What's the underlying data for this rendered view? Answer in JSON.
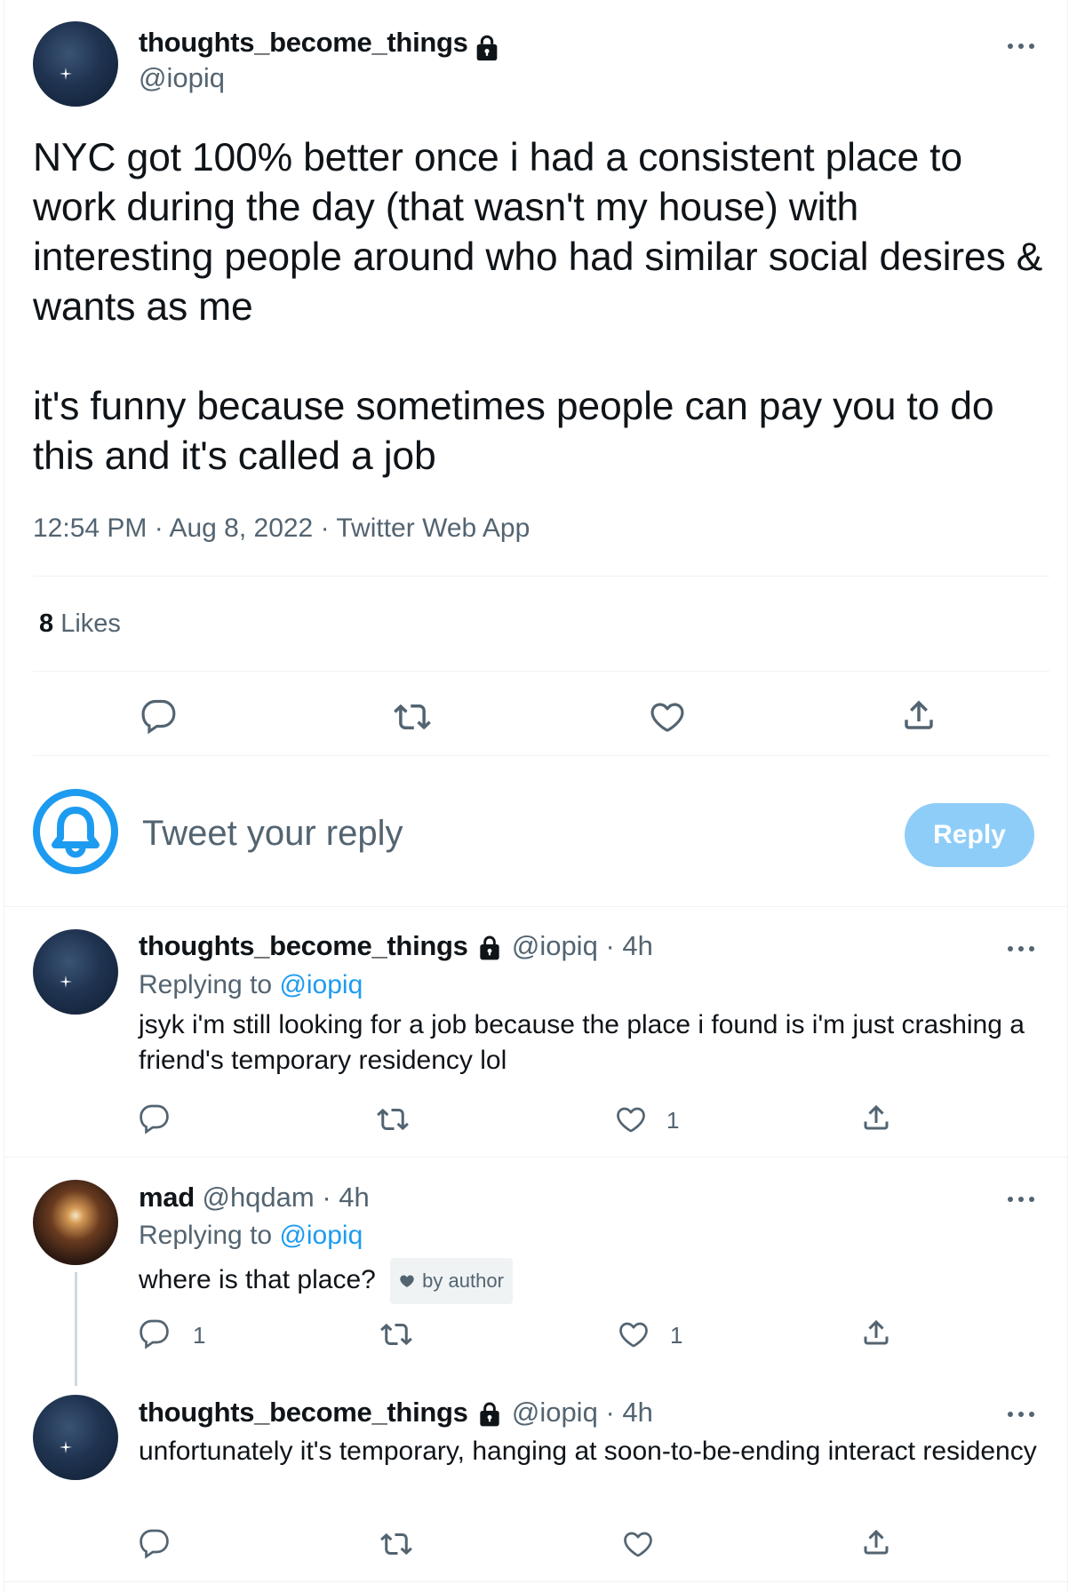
{
  "main_tweet": {
    "display_name": "thoughts_become_things",
    "handle": "@iopiq",
    "text": "NYC got 100% better once i had a consistent place to work during the day (that wasn't my house) with interesting people around who had similar social desires & wants as me\n\nit's funny because sometimes people can pay you to do this and it's called a job",
    "time": "12:54 PM",
    "date": "Aug 8, 2022",
    "source": "Twitter Web App",
    "likes_count": "8",
    "likes_label": "Likes"
  },
  "compose": {
    "placeholder": "Tweet your reply",
    "reply_button": "Reply"
  },
  "replies": [
    {
      "display_name": "thoughts_become_things",
      "handle": "@iopiq",
      "age": "· 4h",
      "replying_label": "Replying to",
      "replying_to": "@iopiq",
      "text": "jsyk i'm still looking for a job because the place i found is i'm just crashing a friend's temporary residency lol",
      "like_count": "1"
    },
    {
      "display_name": "mad",
      "handle": "@hqdam",
      "age": "· 4h",
      "replying_label": "Replying to",
      "replying_to": "@iopiq",
      "text": "where is that place?",
      "badge": "by author",
      "reply_count": "1",
      "like_count": "1"
    },
    {
      "display_name": "thoughts_become_things",
      "handle": "@iopiq",
      "age": "· 4h",
      "text": "unfortunately it's temporary, hanging at soon-to-be-ending interact residency"
    }
  ],
  "icons": {
    "reply": "reply-icon",
    "retweet": "retweet-icon",
    "like": "heart-icon",
    "share": "share-icon",
    "more": "more-icon",
    "lock": "lock-icon"
  },
  "colors": {
    "accent": "#1d9bf0",
    "reply_button": "#8ecdf8",
    "secondary_text": "#536471"
  }
}
